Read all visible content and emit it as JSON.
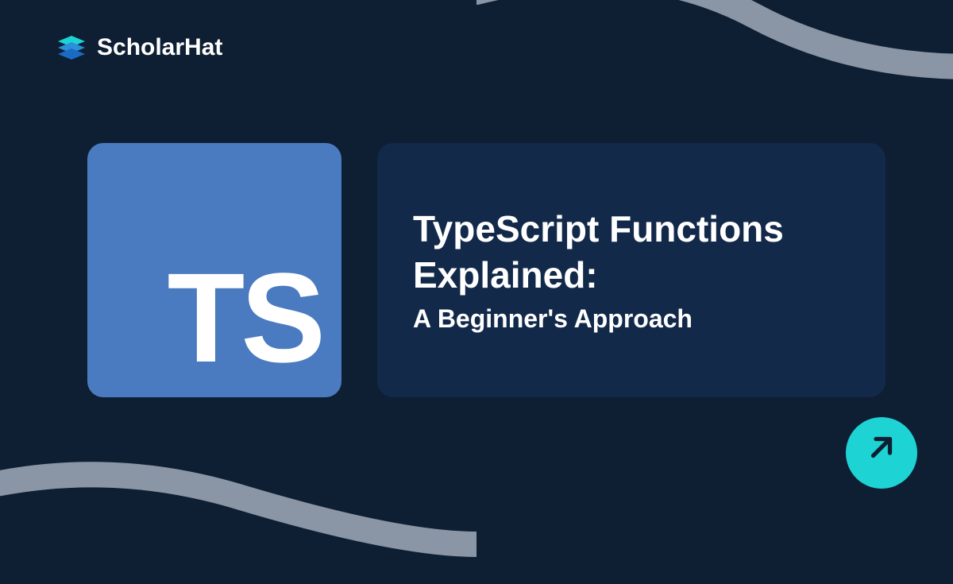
{
  "logo": {
    "brand_name": "ScholarHat"
  },
  "ts_badge": {
    "text": "TS"
  },
  "title": {
    "main": "TypeScript Functions Explained:",
    "sub": "A Beginner's Approach"
  },
  "colors": {
    "background": "#0f1f33",
    "ts_box": "#4a7bc0",
    "title_card": "#13294a",
    "accent": "#1dd3d3",
    "curve": "#8a96a5"
  }
}
